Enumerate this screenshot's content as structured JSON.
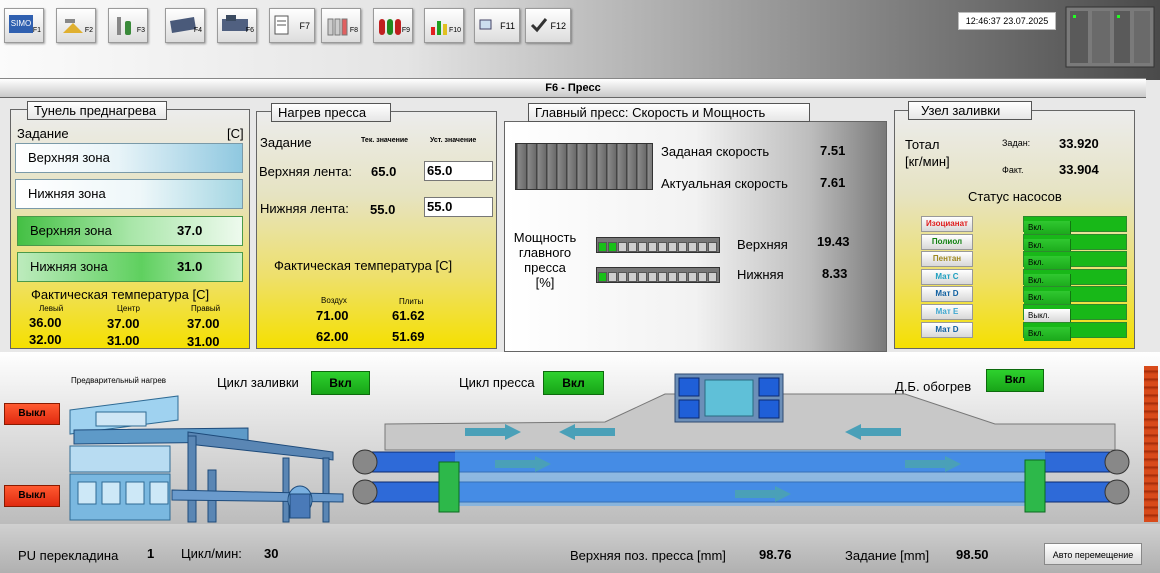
{
  "toolbar": {
    "keys": [
      "F1",
      "F2",
      "F3",
      "F4",
      "F6",
      "F7",
      "F8",
      "F9",
      "F10",
      "F11",
      "F12"
    ],
    "icons": [
      "simatic-icon",
      "tools-icon",
      "wrench-icon",
      "conveyor-icon",
      "machine-icon",
      "report-icon",
      "tanks-icon",
      "pumps-icon",
      "chart-icon",
      "window-icon",
      "check-icon"
    ]
  },
  "clock": "12:46:37  23.07.2025",
  "screen_title": "F6 - Пресс",
  "tunnel": {
    "title": "Тунель преднагрева",
    "setpoint_label": "Задание",
    "unit": "[C]",
    "upper_zone": "Верхняя зона",
    "lower_zone": "Нижняя зона",
    "upper_zone_actual_label": "Верхняя зона",
    "upper_zone_actual": "37.0",
    "lower_zone_actual_label": "Нижняя зона",
    "lower_zone_actual": "31.0",
    "actual_temp_label": "Фактическая температура [C]",
    "col_left": "Левый",
    "col_center": "Центр",
    "col_right": "Правый",
    "row1": [
      "36.00",
      "37.00",
      "37.00"
    ],
    "row2": [
      "32.00",
      "31.00",
      "31.00"
    ]
  },
  "press_heat": {
    "title": "Нагрев пресса",
    "setpoint_label": "Задание",
    "cur_value_label": "Тек. значение",
    "set_value_label": "Уст. значение",
    "upper_belt_label": "Верхняя лента:",
    "upper_belt_cur": "65.0",
    "upper_belt_set": "65.0",
    "lower_belt_label": "Нижняя лента:",
    "lower_belt_cur": "55.0",
    "lower_belt_set": "55.0",
    "actual_temp_label": "Фактическая температура [C]",
    "air_label": "Воздух",
    "plates_label": "Плиты",
    "air_row1": "71.00",
    "plates_row1": "61.62",
    "air_row2": "62.00",
    "plates_row2": "51.69"
  },
  "main_press": {
    "title": "Главный пресс: Скорость и Мощность",
    "set_speed_label": "Заданая скорость",
    "set_speed": "7.51",
    "actual_speed_label": "Актуальная скорость",
    "actual_speed": "7.61",
    "power_label_1": "Мощность",
    "power_label_2": "главного",
    "power_label_3": "пресса",
    "power_label_4": "[%]",
    "upper_label": "Верхняя",
    "upper_value": "19.43",
    "upper_segments_on": 2,
    "lower_label": "Нижняя",
    "lower_value": "8.33",
    "lower_segments_on": 1,
    "segments_total": 12
  },
  "pouring": {
    "title": "Узел заливки",
    "total_label_1": "Тотал",
    "total_label_2": "[кг/мин]",
    "set_label": "Задан:",
    "set_value": "33.920",
    "actual_label": "Факт.",
    "actual_value": "33.904",
    "pumps_status_label": "Статус насосов",
    "pumps": [
      {
        "name": "Изоцианат",
        "color": "#e02020",
        "state": "Вкл."
      },
      {
        "name": "Полиол",
        "color": "#108010",
        "state": "Вкл."
      },
      {
        "name": "Пентан",
        "color": "#a08a20",
        "state": "Вкл."
      },
      {
        "name": "Мат С",
        "color": "#20a0c0",
        "state": "Вкл."
      },
      {
        "name": "Мат D",
        "color": "#1060a0",
        "state": "Вкл."
      },
      {
        "name": "Мат Е",
        "color": "#40a8d0",
        "state": "Выкл."
      },
      {
        "name": "Мат D",
        "color": "#1060a0",
        "state": "Вкл."
      }
    ]
  },
  "process": {
    "preheat_label": "Предварительный нагрев",
    "pour_cycle_label": "Цикл заливки",
    "pour_cycle_state": "Вкл",
    "press_cycle_label": "Цикл пресса",
    "press_cycle_state": "Вкл",
    "db_heat_label": "Д.Б. обогрев",
    "db_heat_state": "Вкл",
    "off1": "Выкл",
    "off2": "Выкл"
  },
  "bottom": {
    "pu_label": "PU перекладина",
    "pu_value": "1",
    "cycles_label": "Цикл/мин:",
    "cycles_value": "30",
    "upper_pos_label": "Верхняя поз. пресса [mm]",
    "upper_pos_value": "98.76",
    "setpoint_label": "Задание [mm]",
    "setpoint_value": "98.50",
    "auto_move_label": "Авто перемещение"
  }
}
